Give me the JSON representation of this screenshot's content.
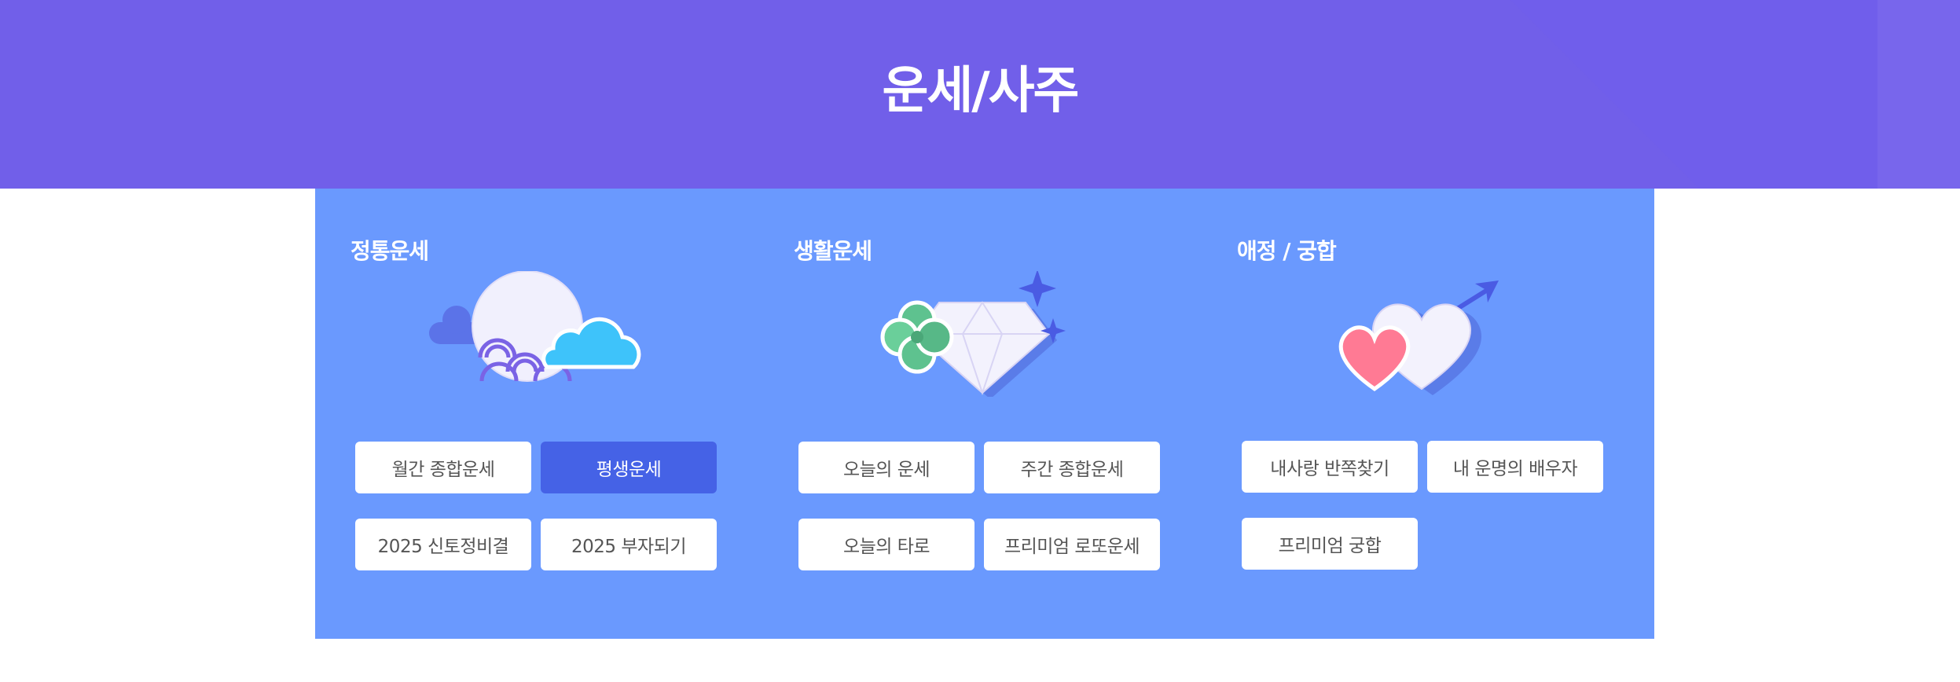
{
  "header": {
    "title": "운세/사주"
  },
  "colors": {
    "header_bg": "#715fe9",
    "panel_bg": "#6a99fe",
    "active_button": "#4562e6"
  },
  "categories": [
    {
      "title": "정통운세",
      "icon": "moon-cloud-icon",
      "buttons": [
        "월간 종합운세",
        "평생운세",
        "2025 신토정비결",
        "2025 부자되기"
      ],
      "active_index": 1
    },
    {
      "title": "생활운세",
      "icon": "diamond-clover-icon",
      "buttons": [
        "오늘의 운세",
        "주간 종합운세",
        "오늘의 타로",
        "프리미엄 로또운세"
      ]
    },
    {
      "title": "애정 / 궁합",
      "icon": "hearts-arrow-icon",
      "buttons": [
        "내사랑 반쪽찾기",
        "내 운명의 배우자",
        "프리미엄 궁합"
      ]
    }
  ]
}
